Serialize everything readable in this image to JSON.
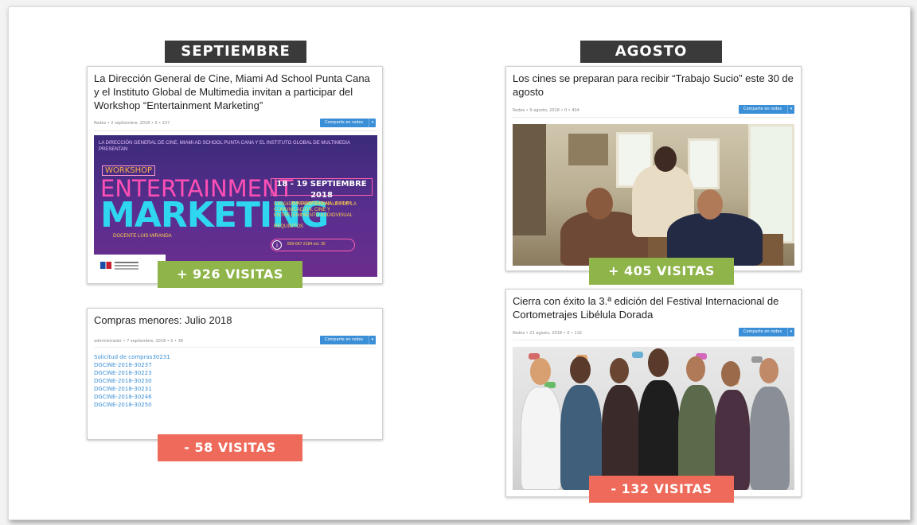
{
  "months": {
    "left": "SEPTIEMBRE",
    "right": "AGOSTO"
  },
  "cards": {
    "workshop": {
      "title": "La Dirección General de Cine, Miami Ad School Punta Cana y el Instituto Global de Multimedia invitan a participar del Workshop “Entertainment Marketing”",
      "meta": "Redes  •  2 septiembre, 2018  •  0  •  227",
      "share": "Comparte en redes",
      "badge": "+ 926 VISITAS",
      "poster": {
        "top": "LA DIRECCIÓN GENERAL DE CINE, MIAMI AD SCHOOL PUNTA CANA Y EL INSTITUTO GLOBAL DE MULTIMEDIA PRESENTAN",
        "workshop": "WORKSHOP",
        "line1": "ENTERTAINMENT",
        "line2": "MARKETING",
        "docente": "DOCENTE LUIS MIRANDA",
        "date": "18 - 19 SEPTIEMBRE 2018",
        "date_sub": "FUNGLODE  9:00 AM - 6:00 PM",
        "dirigido": "DIRIGIDO A PROFESIONALES DE LA COMUNICACIÓN, CINE Y ENTRETENIMIENTO AUDIOVISUAL",
        "requisitos": "REQUISITOS",
        "contact": "809-687-2184 ext. 30"
      }
    },
    "compras": {
      "title": "Compras menores: Julio 2018",
      "meta": "administrador  •  7 septiembre, 2018  •  0  •  38",
      "share": "Comparte en redes",
      "links": [
        "Solicitud de compras30231",
        "DGCINE-2018-30237",
        "DGCINE-2018-30223",
        "DGCINE-2018-30230",
        "DGCINE-2018-30231",
        "DGCINE-2018-30246",
        "DGCINE-2018-30250"
      ],
      "badge": "- 58 VISITAS"
    },
    "cines": {
      "title": "Los cines se preparan para recibir “Trabajo Sucio” este 30 de agosto",
      "meta": "Redes  •  9 agosto, 2018  •  0  •  404",
      "share": "Comparte en redes",
      "badge": "+ 405 VISITAS"
    },
    "festival": {
      "title": "Cierra con éxito la 3.ª edición del Festival Internacional de Cortometrajes Libélula Dorada",
      "meta": "Redes  •  21 agosto, 2018  •  0  •  132",
      "share": "Comparte en redes",
      "badge": "- 132 VISITAS"
    }
  },
  "colors": {
    "positive": "#8fb44a",
    "negative": "#ee6a5a",
    "label_bg": "#3a3a3a",
    "share": "#3a8fd6"
  }
}
